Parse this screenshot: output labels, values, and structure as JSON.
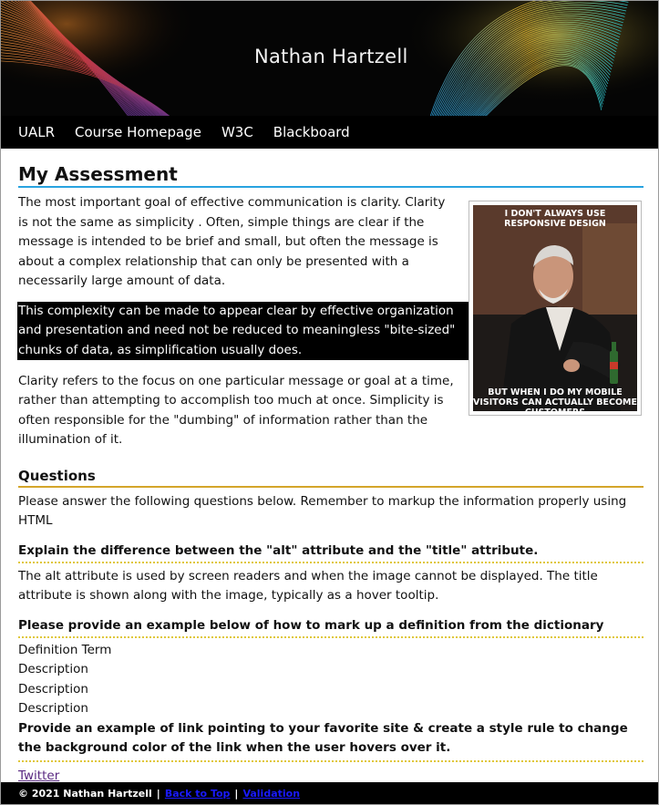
{
  "header": {
    "title": "Nathan Hartzell"
  },
  "nav": {
    "items": [
      "UALR",
      "Course Homepage",
      "W3C",
      "Blackboard"
    ]
  },
  "main": {
    "heading": "My Assessment",
    "paragraph1": "The most important goal of effective communication is clarity. Clarity is not the same as simplicity . Often, simple things are clear if the message is intended to be brief and small, but often the message is about a complex relationship that can only be presented with a necessarily large amount of data.",
    "highlight": "This complexity can be made to appear clear by effective organization and presentation and need not be reduced to meaningless \"bite-sized\" chunks of data, as simplification usually does.",
    "paragraph3": "Clarity refers to the focus on one particular message or goal at a time, rather than attempting to accomplish too much at once. Simplicity is often responsible for the \"dumbing\" of information rather than the illumination of it.",
    "meme": {
      "top_text": "I DON'T ALWAYS USE RESPONSIVE DESIGN",
      "bottom_text": "BUT WHEN I DO MY MOBILE VISITORS CAN ACTUALLY BECOME CUSTOMERS"
    }
  },
  "questions": {
    "heading": "Questions",
    "intro": "Please answer the following questions below. Remember to markup the information properly using HTML",
    "q1": "Explain the difference between the \"alt\" attribute and the \"title\" attribute.",
    "a1": "The alt attribute is used by screen readers and when the image cannot be displayed. The title attribute is shown along with the image, typically as a hover tooltip.",
    "q2": "Please provide an example below of how to mark up a definition from the dictionary",
    "definition_term": "Definition Term",
    "descriptions": [
      "Description",
      "Description",
      "Description"
    ],
    "q3": "Provide an example of link pointing to your favorite site & create a style rule to change the background color of the link when the user hovers over it.",
    "link_text": "Twitter"
  },
  "footer": {
    "copyright": "© 2021 Nathan Hartzell",
    "back_to_top": "Back to Top",
    "validation": "Validation",
    "separator": "|"
  }
}
